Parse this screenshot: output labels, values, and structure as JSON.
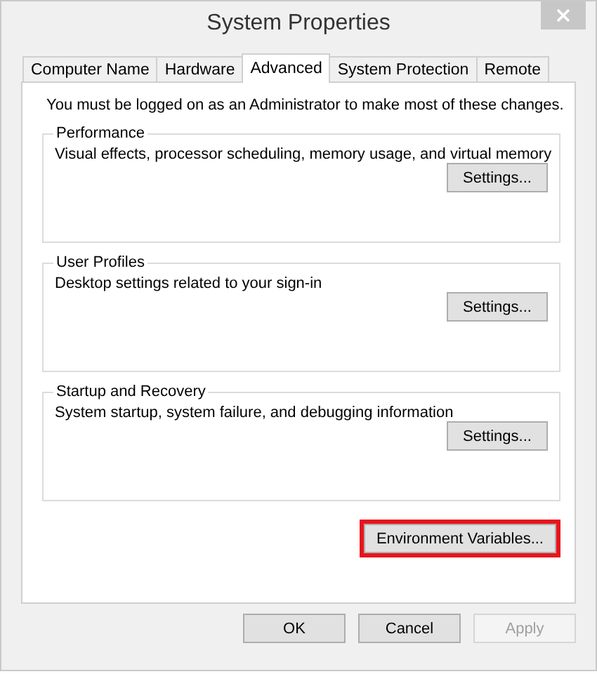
{
  "window": {
    "title": "System Properties"
  },
  "tabs": [
    {
      "label": "Computer Name",
      "selected": false
    },
    {
      "label": "Hardware",
      "selected": false
    },
    {
      "label": "Advanced",
      "selected": true
    },
    {
      "label": "System Protection",
      "selected": false
    },
    {
      "label": "Remote",
      "selected": false
    }
  ],
  "notice": "You must be logged on as an Administrator to make most of these changes.",
  "groups": [
    {
      "title": "Performance",
      "description": "Visual effects, processor scheduling, memory usage, and virtual memory",
      "button": "Settings..."
    },
    {
      "title": "User Profiles",
      "description": "Desktop settings related to your sign-in",
      "button": "Settings..."
    },
    {
      "title": "Startup and Recovery",
      "description": "System startup, system failure, and debugging information",
      "button": "Settings..."
    }
  ],
  "environment_button": {
    "label": "Environment Variables...",
    "highlighted": true
  },
  "buttons": [
    {
      "label": "OK",
      "disabled": false
    },
    {
      "label": "Cancel",
      "disabled": false
    },
    {
      "label": "Apply",
      "disabled": true
    }
  ]
}
